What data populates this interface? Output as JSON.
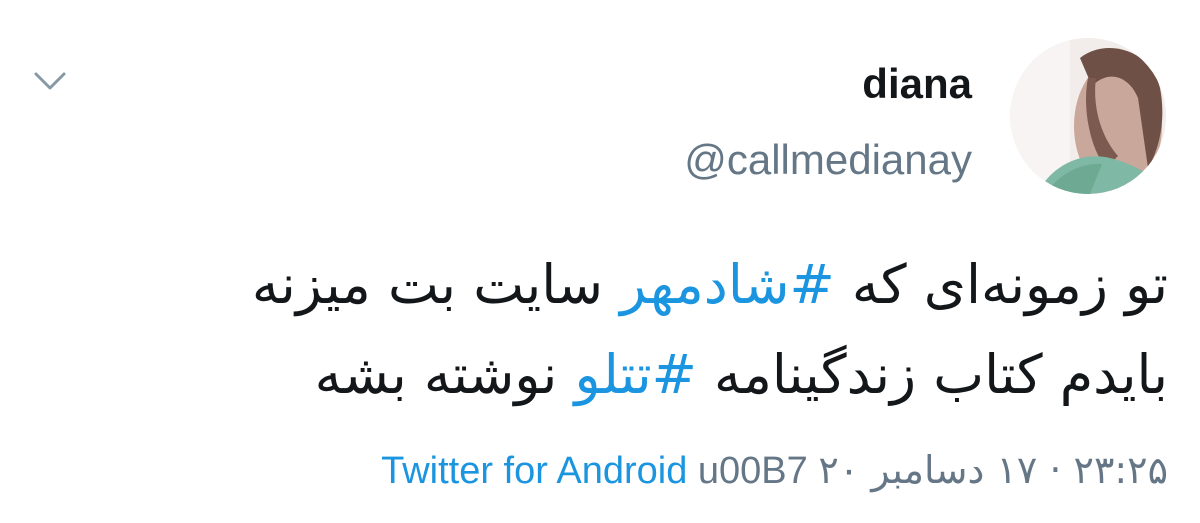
{
  "user": {
    "display_name": "diana",
    "handle": "@callmedianay"
  },
  "tweet": {
    "line1": {
      "before": "تو زمونه‌ای که ",
      "hashtag": "#شادمهر",
      "after": " سایت بت میزنه"
    },
    "line2": {
      "before": "بایدم کتاب زندگینامه ",
      "hashtag": "#تتلو",
      "after": " نوشته بشه"
    }
  },
  "meta": {
    "date_time": "۲۳:۲۵ · ۱۷ دسامبر ۲۰",
    "separator": "u00B7",
    "source": "Twitter for Android"
  },
  "icons": {
    "menu": "chevron-down-icon",
    "avatar": "profile-avatar"
  },
  "colors": {
    "link": "#1b95e0",
    "secondary_text": "#657786",
    "primary_text": "#14171a"
  }
}
